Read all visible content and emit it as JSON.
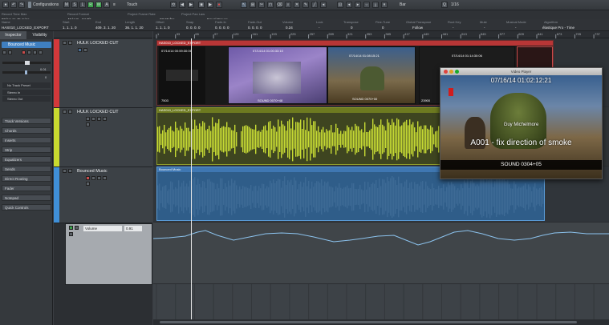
{
  "toolbar": {
    "configurations": "Configurations",
    "touch_mode": "Touch",
    "grid_mode": "Bar",
    "quantize": "1/16",
    "transport_icons": [
      "cycle-icon",
      "rewind-icon",
      "forward-icon",
      "stop-icon",
      "play-icon",
      "record-icon"
    ]
  },
  "infoline": {
    "headers": [
      "Record Time Max",
      "Record Format",
      "Project Frame Rate",
      "Project Pan Law",
      "Name",
      "Start",
      "End",
      "Length",
      "Offset",
      "Snap",
      "Fade-In",
      "Fade-Out",
      "Volume",
      "Lock",
      "Transpose",
      "Fine-Tune",
      "Global Transpose",
      "Root Key",
      "Mute",
      "Musical Mode",
      "Algorithm"
    ],
    "record_time": "98 hours 45 mins",
    "record_format": "48 kHz - 24 Bit",
    "frame_rate": "23.98 fps",
    "pan_law": "Equal Power",
    "name": "HAS010_LOCKED_EXPORT",
    "start": "1. 1. 1. 0",
    "end": "409. 3. 1. 20",
    "length": "36. 1. 1. 20",
    "offset": "1. 1. 1. 0",
    "snap": "0. 0. 0. 0",
    "fade_in": "0. 0. 0. 0",
    "fade_out": "0. 0. 0. 0",
    "volume": "0.24",
    "lock": "-",
    "transpose": "0",
    "fine_tune": "0",
    "global_transpose": "Follow",
    "root_key": "-",
    "mute": "-",
    "musical_mode": "-",
    "algorithm": "élastique Pro - Time"
  },
  "inspector": {
    "tabs": [
      "Inspector",
      "Visibility"
    ],
    "track_name": "Bounced Music",
    "fader_value": "0.01",
    "pan_value": "0",
    "no_track_preset": "No Track Preset",
    "stereo_in": "Stereo In",
    "stereo_out": "Stereo Out",
    "sections": [
      "Track Versions",
      "Chords",
      "Inserts",
      "Strip",
      "Equalizers",
      "Sends",
      "Direct Routing",
      "Fader",
      "Notepad",
      "Quick Controls"
    ]
  },
  "tracks": [
    {
      "name": "HULK LOCKED CUT",
      "color": "#d3383a"
    },
    {
      "name": "HULK LOCKED CUT",
      "color": "#c8da2f"
    },
    {
      "name": "Bounced Music",
      "color": "#3f8fd8"
    }
  ],
  "automation": {
    "param": "Volume",
    "value": "0.91"
  },
  "ruler": [
    "1",
    "33",
    "65",
    "97",
    "129",
    "161",
    "193",
    "225",
    "257",
    "289",
    "321",
    "353",
    "385",
    "417",
    "449",
    "481",
    "513",
    "545",
    "577",
    "609",
    "641",
    "673",
    "705",
    "737"
  ],
  "video_clip_name": "HAS010_LOCKED_EXPORT",
  "video_thumbs": [
    {
      "timecode": "07/14/14 00:59:30:06",
      "sound": "7503"
    },
    {
      "timecode": "07/14/14 01:00:33:10",
      "sound": "SOUND 0070+48"
    },
    {
      "timecode": "07/14/14 01:08:15:21",
      "sound": "SOUND 0070+00"
    },
    {
      "timecode": "07/14/14 01:14:30:06",
      "sound": "23900"
    }
  ],
  "audio_clip_name": "HAS010_LOCKED_EXPORT",
  "music_clip_name": "Bounced Music",
  "video_window": {
    "title": "Video Player",
    "timecode": "07/16/14 01:02:12:21",
    "caption_name": "Guy Michelmore",
    "caption_line": "A001 - fix direction of smoke",
    "sound": "SOUND 0304+05"
  },
  "colors": {
    "video_track": "#d3383a",
    "audio_track": "#c8da2f",
    "music_track": "#3f8fd8"
  }
}
